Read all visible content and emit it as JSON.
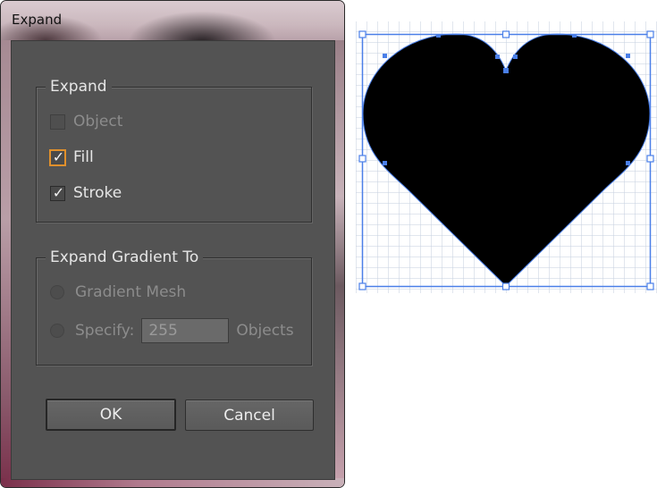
{
  "dialog": {
    "title": "Expand",
    "expand_group": {
      "legend": "Expand",
      "object_label": "Object",
      "object_checked": false,
      "fill_label": "Fill",
      "fill_checked": true,
      "stroke_label": "Stroke",
      "stroke_checked": true
    },
    "gradient_group": {
      "legend": "Expand Gradient To",
      "gradient_mesh_label": "Gradient Mesh",
      "specify_label": "Specify:",
      "specify_value": "255",
      "objects_label": "Objects"
    },
    "ok_label": "OK",
    "cancel_label": "Cancel"
  },
  "check_glyph": "✓",
  "colors": {
    "dialog_bg": "#535353",
    "focus_orange": "#e0902c",
    "selection_blue": "#4a7fe8",
    "heart_fill": "#000000"
  }
}
